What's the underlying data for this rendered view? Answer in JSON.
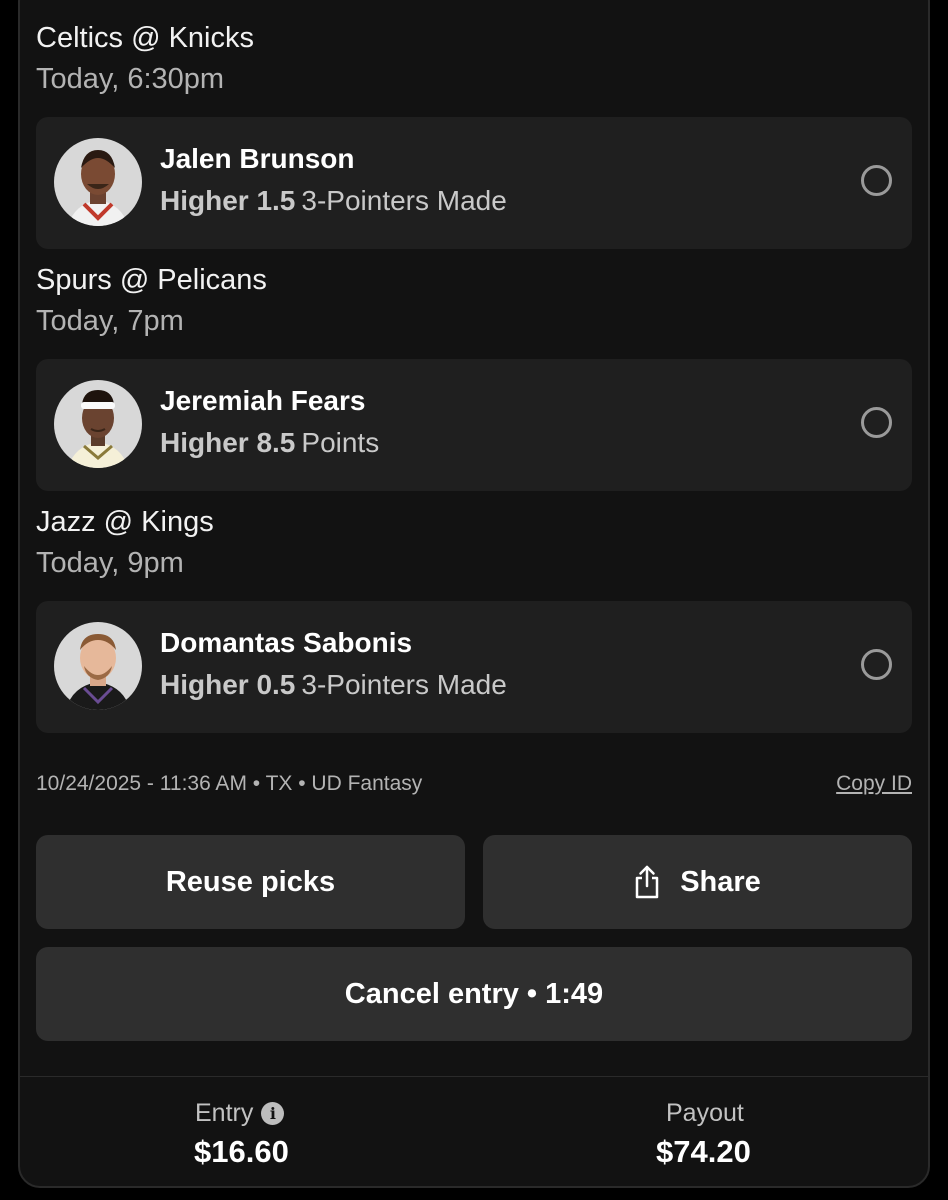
{
  "games": [
    {
      "matchup": "Celtics @ Knicks",
      "time": "Today, 6:30pm",
      "pick": {
        "player": "Jalen Brunson",
        "direction": "Higher 1.5",
        "stat": "3-Pointers Made"
      }
    },
    {
      "matchup": "Spurs @ Pelicans",
      "time": "Today, 7pm",
      "pick": {
        "player": "Jeremiah Fears",
        "direction": "Higher 8.5",
        "stat": "Points"
      }
    },
    {
      "matchup": "Jazz @ Kings",
      "time": "Today, 9pm",
      "pick": {
        "player": "Domantas Sabonis",
        "direction": "Higher 0.5",
        "stat": "3-Pointers Made"
      }
    }
  ],
  "meta": {
    "text": "10/24/2025 - 11:36 AM • TX • UD Fantasy",
    "copy_id": "Copy ID"
  },
  "actions": {
    "reuse": "Reuse picks",
    "share": "Share",
    "cancel": "Cancel entry • 1:49"
  },
  "summary": {
    "entry_label": "Entry",
    "entry_value": "$16.60",
    "payout_label": "Payout",
    "payout_value": "$74.20"
  },
  "icons": {
    "share": "share-icon",
    "info": "info-icon",
    "radio": "radio-unselected"
  }
}
